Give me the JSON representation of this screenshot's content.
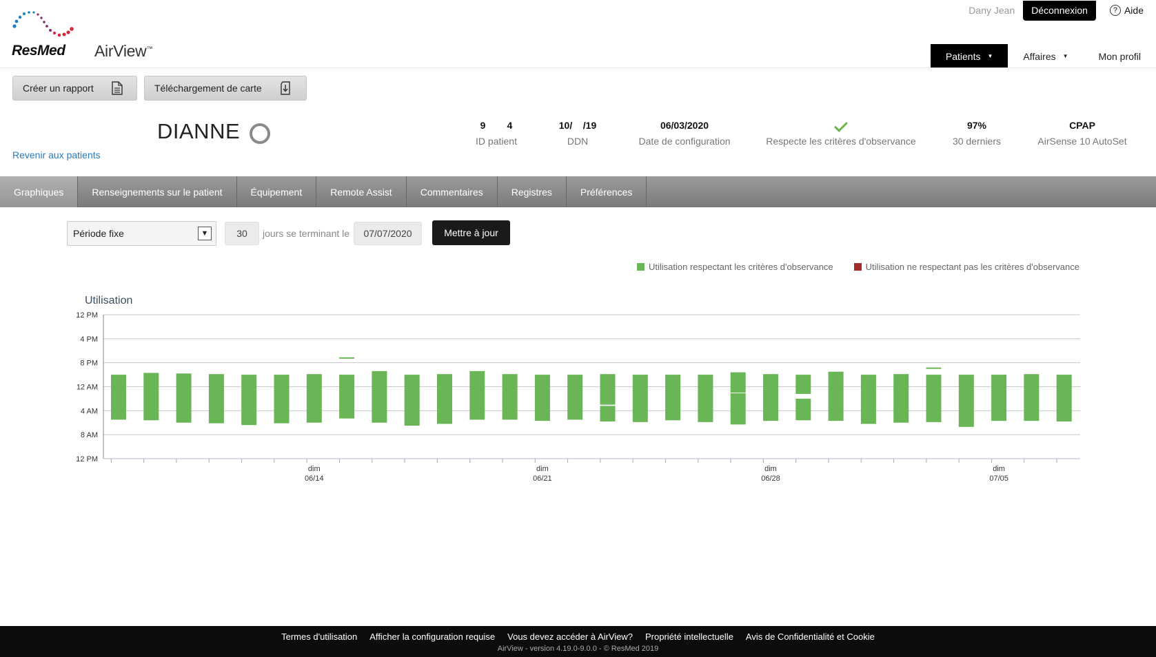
{
  "header": {
    "user_name": "Dany Jean",
    "logout_label": "Déconnexion",
    "help_label": "Aide",
    "logo_text": "ResMed",
    "product_name": "AirView",
    "product_tm": "™",
    "nav": {
      "patients": "Patients",
      "affaires": "Affaires",
      "profile": "Mon profil"
    }
  },
  "actions": {
    "create_report": "Créer un rapport",
    "card_download": "Téléchargement de carte"
  },
  "patient": {
    "name": "DIANNE",
    "back_link": "Revenir aux patients",
    "id_value": "9        4",
    "id_label": "ID patient",
    "dob_value": "10/    /19",
    "dob_label": "DDN",
    "setup_value": "06/03/2020",
    "setup_label": "Date de configuration",
    "compliance_label": "Respecte les critères d'observance",
    "percent_value": "97%",
    "percent_label": "30 derniers",
    "device_value": "CPAP",
    "device_label": "AirSense 10 AutoSet"
  },
  "tabs": [
    {
      "label": "Graphiques"
    },
    {
      "label": "Renseignements sur le patient"
    },
    {
      "label": "Équipement"
    },
    {
      "label": "Remote Assist"
    },
    {
      "label": "Commentaires"
    },
    {
      "label": "Registres"
    },
    {
      "label": "Préférences"
    }
  ],
  "controls": {
    "period_selected": "Période fixe",
    "days_value": "30",
    "days_text": "jours se terminant le",
    "end_date": "07/07/2020",
    "update_label": "Mettre à jour"
  },
  "legend": {
    "compliant": "Utilisation respectant les critères d'observance",
    "non_compliant": "Utilisation ne respectant pas les critères d'observance"
  },
  "colors": {
    "compliant": "#6ab556",
    "non_compliant": "#a52a2a",
    "accent": "#000000"
  },
  "chart_data": {
    "type": "bar",
    "title": "Utilisation",
    "y_axis_ticks": [
      "12 PM",
      "4 PM",
      "8 PM",
      "12 AM",
      "4 AM",
      "8 AM",
      "12 PM"
    ],
    "ylim_hours": [
      12,
      36
    ],
    "x_axis_ticks": [
      {
        "day": "dim",
        "date": "06/14",
        "index": 6
      },
      {
        "day": "dim",
        "date": "06/21",
        "index": 13
      },
      {
        "day": "dim",
        "date": "06/28",
        "index": 20
      },
      {
        "day": "dim",
        "date": "07/05",
        "index": 27
      }
    ],
    "series": [
      {
        "name": "Utilisation respectant les critères d'observance",
        "days": [
          {
            "date": "06/08",
            "segments": [
              [
                22.0,
                29.5
              ]
            ]
          },
          {
            "date": "06/09",
            "segments": [
              [
                21.7,
                29.6
              ]
            ]
          },
          {
            "date": "06/10",
            "segments": [
              [
                21.8,
                30.0
              ]
            ]
          },
          {
            "date": "06/11",
            "segments": [
              [
                21.9,
                30.1
              ]
            ]
          },
          {
            "date": "06/12",
            "segments": [
              [
                22.0,
                30.4
              ]
            ]
          },
          {
            "date": "06/13",
            "segments": [
              [
                22.0,
                30.1
              ]
            ]
          },
          {
            "date": "06/14",
            "segments": [
              [
                21.9,
                30.0
              ]
            ]
          },
          {
            "date": "06/15",
            "segments": [
              [
                19.1,
                19.2
              ],
              [
                22.0,
                29.3
              ]
            ]
          },
          {
            "date": "06/16",
            "segments": [
              [
                21.4,
                30.0
              ]
            ]
          },
          {
            "date": "06/17",
            "segments": [
              [
                22.0,
                30.5
              ]
            ]
          },
          {
            "date": "06/18",
            "segments": [
              [
                21.9,
                30.2
              ]
            ]
          },
          {
            "date": "06/19",
            "segments": [
              [
                21.4,
                29.5
              ]
            ]
          },
          {
            "date": "06/20",
            "segments": [
              [
                21.9,
                29.5
              ]
            ]
          },
          {
            "date": "06/21",
            "segments": [
              [
                22.0,
                29.7
              ]
            ]
          },
          {
            "date": "06/22",
            "segments": [
              [
                22.0,
                29.5
              ]
            ]
          },
          {
            "date": "06/23",
            "segments": [
              [
                21.9,
                27.0
              ],
              [
                27.2,
                29.8
              ]
            ]
          },
          {
            "date": "06/24",
            "segments": [
              [
                22.0,
                29.9
              ]
            ]
          },
          {
            "date": "06/25",
            "segments": [
              [
                22.0,
                29.6
              ]
            ]
          },
          {
            "date": "06/26",
            "segments": [
              [
                22.0,
                29.9
              ]
            ]
          },
          {
            "date": "06/27",
            "segments": [
              [
                21.6,
                25.0
              ],
              [
                25.1,
                30.3
              ]
            ]
          },
          {
            "date": "06/28",
            "segments": [
              [
                21.9,
                29.7
              ]
            ]
          },
          {
            "date": "06/29",
            "segments": [
              [
                22.0,
                25.2
              ],
              [
                26.0,
                29.6
              ]
            ]
          },
          {
            "date": "06/30",
            "segments": [
              [
                21.5,
                29.7
              ]
            ]
          },
          {
            "date": "07/01",
            "segments": [
              [
                22.0,
                30.2
              ]
            ]
          },
          {
            "date": "07/02",
            "segments": [
              [
                21.9,
                30.0
              ]
            ]
          },
          {
            "date": "07/03",
            "segments": [
              [
                20.8,
                20.9
              ],
              [
                22.0,
                29.9
              ]
            ]
          },
          {
            "date": "07/04",
            "segments": [
              [
                22.0,
                30.7
              ]
            ]
          },
          {
            "date": "07/05",
            "segments": [
              [
                22.0,
                29.7
              ]
            ]
          },
          {
            "date": "07/06",
            "segments": [
              [
                21.9,
                29.7
              ]
            ]
          },
          {
            "date": "07/07",
            "segments": [
              [
                22.0,
                29.8
              ]
            ]
          }
        ]
      },
      {
        "name": "Utilisation ne respectant pas les critères d'observance",
        "days": []
      }
    ]
  },
  "footer": {
    "links": [
      "Termes d'utilisation",
      "Afficher la configuration requise",
      "Vous devez accéder à AirView?",
      "Propriété intellectuelle",
      "Avis de Confidentialité et Cookie"
    ],
    "version": "AirView - version 4.19.0-9.0.0  -  © ResMed 2019"
  }
}
